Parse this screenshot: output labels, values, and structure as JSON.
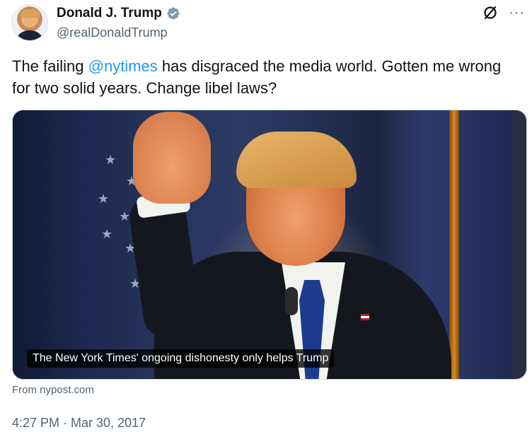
{
  "author": {
    "name": "Donald J. Trump",
    "handle": "@realDonaldTrump",
    "verified": true,
    "avatar_icon": "profile-photo"
  },
  "header_icons": {
    "grok": "grok-icon",
    "more": "···"
  },
  "tweet": {
    "text_before": "The failing ",
    "mention": "@nytimes",
    "text_after": " has disgraced the media world. Gotten me wrong for two solid years. Change libel laws?"
  },
  "card": {
    "caption": "The New York Times' ongoing dishonesty only helps Trump",
    "source": "From nypost.com"
  },
  "meta": {
    "timestamp": "4:27 PM · Mar 30, 2017"
  },
  "colors": {
    "link": "#1d9bf0",
    "secondary_text": "#536471",
    "verified_badge": "#829aab"
  }
}
